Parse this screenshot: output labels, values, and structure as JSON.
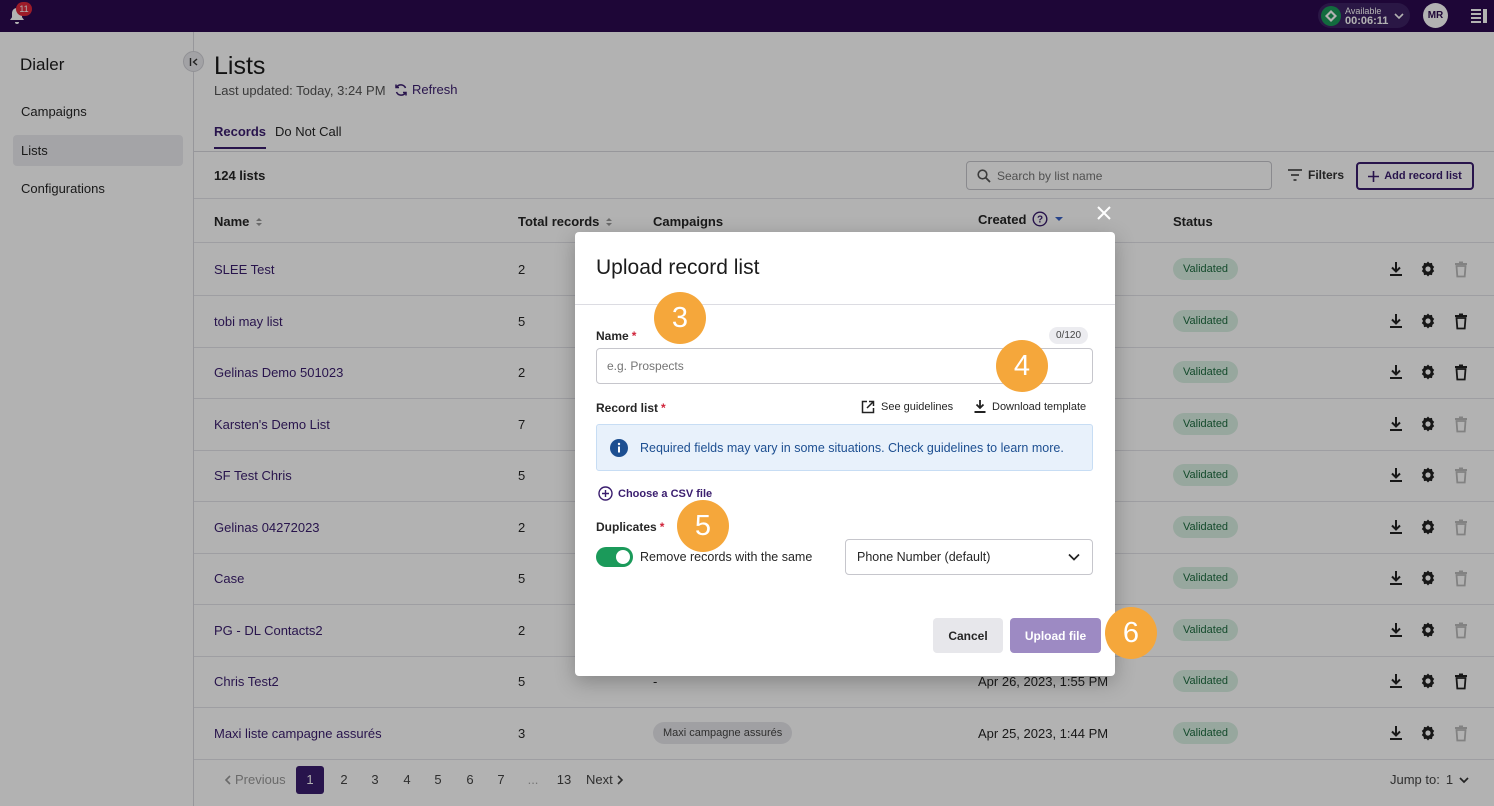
{
  "topbar": {
    "notification_count": "11",
    "status": {
      "label": "Available",
      "timer": "00:06:11"
    },
    "avatar_initials": "MR",
    "icons": [
      "bell-icon",
      "chevron-down-icon",
      "side-panel-icon"
    ]
  },
  "sidebar": {
    "title": "Dialer",
    "items": [
      {
        "label": "Campaigns",
        "active": false
      },
      {
        "label": "Lists",
        "active": true
      },
      {
        "label": "Configurations",
        "active": false
      }
    ]
  },
  "page": {
    "title": "Lists",
    "last_updated": "Last updated: Today, 3:24 PM",
    "refresh_label": "Refresh",
    "tabs": [
      {
        "label": "Records",
        "active": true
      },
      {
        "label": "Do Not Call",
        "active": false
      }
    ]
  },
  "toolbar": {
    "count": "124 lists",
    "search_placeholder": "Search by list name",
    "filters_label": "Filters",
    "add_label": "Add record list"
  },
  "table": {
    "headers": {
      "name": "Name",
      "total": "Total records",
      "campaigns": "Campaigns",
      "created": "Created",
      "status": "Status"
    },
    "rows": [
      {
        "name": "SLEE Test",
        "total": "2",
        "campaign": "",
        "created": "",
        "status": "Validated",
        "delete_enabled": false
      },
      {
        "name": "tobi may list",
        "total": "5",
        "campaign": "",
        "created": "",
        "status": "Validated",
        "delete_enabled": true
      },
      {
        "name": "Gelinas Demo 501023",
        "total": "2",
        "campaign": "",
        "created": "",
        "status": "Validated",
        "delete_enabled": true
      },
      {
        "name": "Karsten's Demo List",
        "total": "7",
        "campaign": "",
        "created": "",
        "status": "Validated",
        "delete_enabled": false
      },
      {
        "name": "SF Test Chris",
        "total": "5",
        "campaign": "",
        "created": "",
        "status": "Validated",
        "delete_enabled": false
      },
      {
        "name": "Gelinas 04272023",
        "total": "2",
        "campaign": "",
        "created": "",
        "status": "Validated",
        "delete_enabled": false
      },
      {
        "name": "Case",
        "total": "5",
        "campaign": "",
        "created": "",
        "status": "Validated",
        "delete_enabled": false
      },
      {
        "name": "PG - DL Contacts2",
        "total": "2",
        "campaign": "",
        "created": "",
        "status": "Validated",
        "delete_enabled": false
      },
      {
        "name": "Chris Test2",
        "total": "5",
        "campaign": "-",
        "created": "Apr 26, 2023, 1:55 PM",
        "status": "Validated",
        "delete_enabled": true
      },
      {
        "name": "Maxi liste campagne assurés",
        "total": "3",
        "campaign_tag": "Maxi campagne assurés",
        "created": "Apr 25, 2023, 1:44 PM",
        "status": "Validated",
        "delete_enabled": false
      }
    ]
  },
  "pagination": {
    "previous": "Previous",
    "pages": [
      "1",
      "2",
      "3",
      "4",
      "5",
      "6",
      "7",
      "...",
      "13"
    ],
    "current": "1",
    "next": "Next",
    "jump_label": "Jump to:",
    "jump_value": "1"
  },
  "modal": {
    "title": "Upload record list",
    "name_label": "Name",
    "required_mark": "*",
    "counter": "0/120",
    "name_placeholder": "e.g. Prospects",
    "record_list_label": "Record list",
    "see_guidelines": "See guidelines",
    "download_template": "Download template",
    "info_text": "Required fields may vary in some situations. Check guidelines to learn more.",
    "choose_csv": "Choose a CSV file",
    "duplicates_label": "Duplicates",
    "toggle_label": "Remove records with the same",
    "toggle_on": true,
    "select_value": "Phone Number (default)",
    "cancel": "Cancel",
    "upload": "Upload file"
  },
  "step_markers": [
    "3",
    "4",
    "5",
    "6"
  ],
  "colors": {
    "brand": "#2b0a4f",
    "accent": "#3a1d6e",
    "success": "#1b9a5a",
    "marker": "#f5a73b",
    "upload_disabled": "#9d8ac3"
  }
}
